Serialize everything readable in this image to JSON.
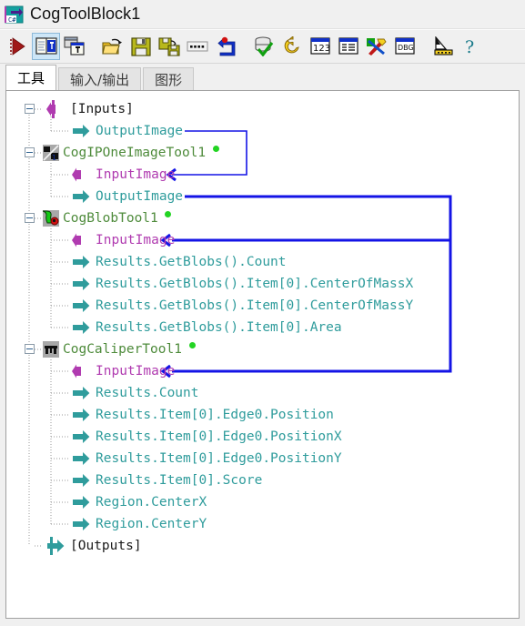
{
  "window": {
    "title": "CogToolBlock1",
    "icon": "cogtoolblock-icon"
  },
  "toolbar": {
    "buttons": [
      {
        "name": "run-button",
        "label": "Run",
        "icon": "red-play-triangle-icon",
        "selected": false
      },
      {
        "name": "show-tools-button",
        "label": "Tools",
        "icon": "tool-list-window-icon",
        "selected": true
      },
      {
        "name": "show-subtools-button",
        "label": "Sub Tools",
        "icon": "stacked-window-icon",
        "selected": false
      },
      {
        "name": "open-button",
        "label": "Open",
        "icon": "open-folder-icon",
        "selected": false
      },
      {
        "name": "save-button",
        "label": "Save",
        "icon": "floppy-disk-icon",
        "selected": false
      },
      {
        "name": "save-as-button",
        "label": "Save As",
        "icon": "floppy-disk-arrow-icon",
        "selected": false
      },
      {
        "name": "filmstrip-button",
        "label": "Film Strip",
        "icon": "filmstrip-icon",
        "selected": false
      },
      {
        "name": "undo-link-button",
        "label": "Link",
        "icon": "blue-arrow-red-dot-icon",
        "selected": false
      },
      {
        "name": "accept-db-button",
        "label": "Accept",
        "icon": "database-check-icon",
        "selected": false
      },
      {
        "name": "reset-button",
        "label": "Reset",
        "icon": "yellow-undo-arrow-icon",
        "selected": false
      },
      {
        "name": "numeric-button",
        "label": "123",
        "icon": "numeric-window-icon",
        "selected": false
      },
      {
        "name": "results-button",
        "label": "Results",
        "icon": "list-window-icon",
        "selected": false
      },
      {
        "name": "tools-settings-button",
        "label": "Settings",
        "icon": "hammer-wrench-icon",
        "selected": false
      },
      {
        "name": "debug-button",
        "label": "DBG",
        "icon": "debug-window-icon",
        "selected": false
      },
      {
        "name": "measure-button",
        "label": "Measure",
        "icon": "ruler-pointer-icon",
        "selected": false
      },
      {
        "name": "help-button",
        "label": "Help",
        "icon": "question-mark-icon",
        "selected": false
      }
    ]
  },
  "tabs": [
    {
      "name": "tab-tools",
      "label": "工具",
      "active": true
    },
    {
      "name": "tab-io",
      "label": "输入/输出",
      "active": false
    },
    {
      "name": "tab-graphics",
      "label": "图形",
      "active": false
    }
  ],
  "tree": {
    "nodes": [
      {
        "name": "tree-node-inputs",
        "label": "[Inputs]",
        "kind": "group",
        "arrow": "input-arrow",
        "color": "black",
        "indent": 0,
        "expander": "minus",
        "status": false
      },
      {
        "name": "tree-terminal-inputs-outputimage",
        "label": "OutputImage",
        "kind": "output",
        "arrow": "output-arrow",
        "color": "teal",
        "indent": 1,
        "expander": "none",
        "status": false
      },
      {
        "name": "tree-node-cogiponeimagetool1",
        "label": "CogIPOneImageTool1",
        "kind": "tool",
        "arrow": "tool-icon-ip",
        "color": "olive",
        "indent": 0,
        "expander": "minus",
        "status": true
      },
      {
        "name": "tree-terminal-ip-inputimage",
        "label": "InputImage",
        "kind": "input",
        "arrow": "input-arrow",
        "color": "purple",
        "indent": 1,
        "expander": "none",
        "status": false
      },
      {
        "name": "tree-terminal-ip-outputimage",
        "label": "OutputImage",
        "kind": "output",
        "arrow": "output-arrow",
        "color": "teal",
        "indent": 1,
        "expander": "none",
        "status": false
      },
      {
        "name": "tree-node-cogblobtool1",
        "label": "CogBlobTool1",
        "kind": "tool",
        "arrow": "tool-icon-blob",
        "color": "olive",
        "indent": 0,
        "expander": "minus",
        "status": true
      },
      {
        "name": "tree-terminal-blob-inputimage",
        "label": "InputImage",
        "kind": "input",
        "arrow": "input-arrow",
        "color": "purple",
        "indent": 1,
        "expander": "none",
        "status": false
      },
      {
        "name": "tree-terminal-blob-count",
        "label": "Results.GetBlobs().Count",
        "kind": "output",
        "arrow": "output-arrow",
        "color": "teal",
        "indent": 1,
        "expander": "none",
        "status": false
      },
      {
        "name": "tree-terminal-blob-comx",
        "label": "Results.GetBlobs().Item[0].CenterOfMassX",
        "kind": "output",
        "arrow": "output-arrow",
        "color": "teal",
        "indent": 1,
        "expander": "none",
        "status": false
      },
      {
        "name": "tree-terminal-blob-comy",
        "label": "Results.GetBlobs().Item[0].CenterOfMassY",
        "kind": "output",
        "arrow": "output-arrow",
        "color": "teal",
        "indent": 1,
        "expander": "none",
        "status": false
      },
      {
        "name": "tree-terminal-blob-area",
        "label": "Results.GetBlobs().Item[0].Area",
        "kind": "output",
        "arrow": "output-arrow",
        "color": "teal",
        "indent": 1,
        "expander": "none",
        "status": false
      },
      {
        "name": "tree-node-cogcalipertool1",
        "label": "CogCaliperTool1",
        "kind": "tool",
        "arrow": "tool-icon-caliper",
        "color": "olive",
        "indent": 0,
        "expander": "minus",
        "status": true
      },
      {
        "name": "tree-terminal-caliper-inputimage",
        "label": "InputImage",
        "kind": "input",
        "arrow": "input-arrow",
        "color": "purple",
        "indent": 1,
        "expander": "none",
        "status": false
      },
      {
        "name": "tree-terminal-caliper-count",
        "label": "Results.Count",
        "kind": "output",
        "arrow": "output-arrow",
        "color": "teal",
        "indent": 1,
        "expander": "none",
        "status": false
      },
      {
        "name": "tree-terminal-caliper-pos",
        "label": "Results.Item[0].Edge0.Position",
        "kind": "output",
        "arrow": "output-arrow",
        "color": "teal",
        "indent": 1,
        "expander": "none",
        "status": false
      },
      {
        "name": "tree-terminal-caliper-posx",
        "label": "Results.Item[0].Edge0.PositionX",
        "kind": "output",
        "arrow": "output-arrow",
        "color": "teal",
        "indent": 1,
        "expander": "none",
        "status": false
      },
      {
        "name": "tree-terminal-caliper-posy",
        "label": "Results.Item[0].Edge0.PositionY",
        "kind": "output",
        "arrow": "output-arrow",
        "color": "teal",
        "indent": 1,
        "expander": "none",
        "status": false
      },
      {
        "name": "tree-terminal-caliper-score",
        "label": "Results.Item[0].Score",
        "kind": "output",
        "arrow": "output-arrow",
        "color": "teal",
        "indent": 1,
        "expander": "none",
        "status": false
      },
      {
        "name": "tree-terminal-caliper-centerx",
        "label": "Region.CenterX",
        "kind": "output",
        "arrow": "output-arrow",
        "color": "teal",
        "indent": 1,
        "expander": "none",
        "status": false
      },
      {
        "name": "tree-terminal-caliper-centery",
        "label": "Region.CenterY",
        "kind": "output",
        "arrow": "output-arrow",
        "color": "teal",
        "indent": 1,
        "expander": "none",
        "status": false
      },
      {
        "name": "tree-node-outputs",
        "label": "[Outputs]",
        "kind": "group",
        "arrow": "output-arrow",
        "color": "black",
        "indent": 0,
        "expander": "none",
        "status": false
      }
    ],
    "links": [
      {
        "name": "link-inputs-to-ip",
        "from": "tree-terminal-inputs-outputimage",
        "to": "tree-terminal-ip-inputimage",
        "thickness": 1
      },
      {
        "name": "link-ip-to-blob",
        "from": "tree-terminal-ip-outputimage",
        "to": "tree-terminal-blob-inputimage",
        "thickness": 3
      },
      {
        "name": "link-ip-to-caliper",
        "from": "tree-terminal-ip-outputimage",
        "to": "tree-terminal-caliper-inputimage",
        "thickness": 3
      }
    ]
  },
  "colors": {
    "wire": "#1414e6",
    "terminal_output": "#2f9c9c",
    "terminal_input": "#b03bb0",
    "tool_name": "#4e8b3b",
    "status_ok": "#23d423",
    "tab_active_bg": "#ffffff",
    "toolbar_selected_bg": "#cde6f7",
    "panel_bg": "#ffffff",
    "chrome_bg": "#f0f0f0"
  }
}
